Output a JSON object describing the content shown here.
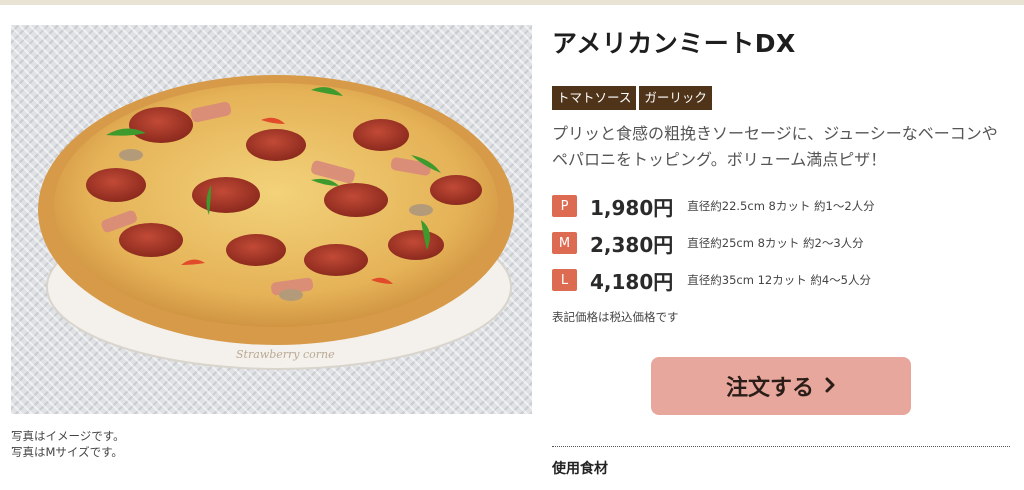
{
  "product": {
    "name": "アメリカンミートDX",
    "tags": [
      "トマトソース",
      "ガーリック"
    ],
    "description": "プリッと食感の粗挽きソーセージに、ジューシーなベーコンやペパロニをトッピング。ボリューム満点ピザ！",
    "image_alt": "ピザの写真",
    "plate_text": "Strawberry corne"
  },
  "caption": {
    "line1": "写真はイメージです。",
    "line2": "写真はMサイズです。"
  },
  "prices": [
    {
      "size": "P",
      "price": "1,980円",
      "detail": "直径約22.5cm 8カット 約1〜2人分"
    },
    {
      "size": "M",
      "price": "2,380円",
      "detail": "直径約25cm 8カット 約2〜3人分"
    },
    {
      "size": "L",
      "price": "4,180円",
      "detail": "直径約35cm 12カット 約4〜5人分"
    }
  ],
  "tax_note": "表記価格は税込価格です",
  "order_button": {
    "label": "注文する",
    "icon": "chevron-right-icon"
  },
  "ingredients_heading": "使用食材",
  "colors": {
    "badge": "#dc6b52",
    "tag_bg": "#4f3419",
    "button_bg": "#e8a79c"
  }
}
